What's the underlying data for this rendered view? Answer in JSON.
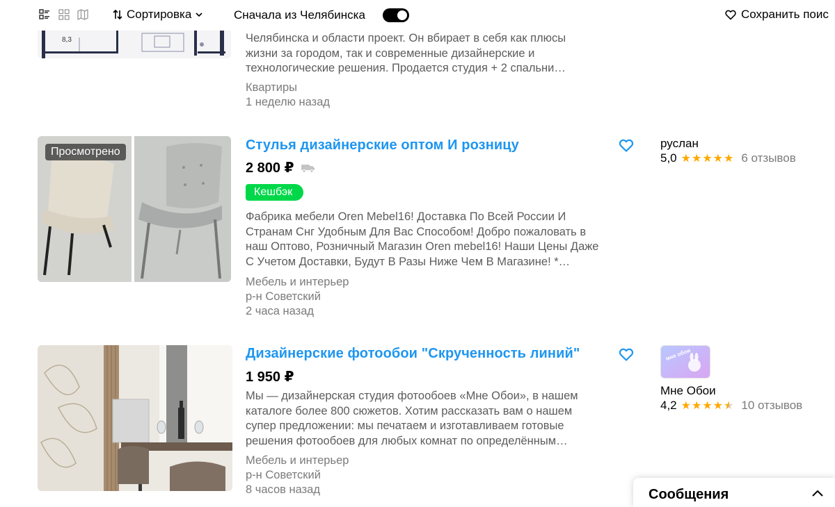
{
  "toolbar": {
    "view_icons": [
      "list-view-icon",
      "grid-view-icon",
      "map-view-icon"
    ],
    "sort_label": "Сортировка",
    "first_from_label": "Сначала из Челябинска",
    "toggle_on": true,
    "save_search_label": "Сохранить поис"
  },
  "listings": [
    {
      "description": "Челябинска и области проект. Он вбирает в себя как плюсы жизни за городом, так и современные дизайнерские и технологические решения. Продается студия + 2 спальни…",
      "description_lines": [
        "Челябинска и области проект. Он вбирает в себя как плюсы",
        "жизни за городом, так и современные дизайнерские и",
        "технологические решения. Продается студия + 2 спальни…"
      ],
      "category": "Квартиры",
      "time": "1 неделю назад",
      "thumb_text": "8,3"
    },
    {
      "viewed_label": "Просмотрено",
      "title": "Стулья дизайнерские оптом И розницу",
      "price": "2 800 ₽",
      "delivery_icon": "truck-icon",
      "cashback_label": "Кешбэк",
      "description_lines": [
        "Фабрика мебели Oren Mebel16! Доставка По Всей России И",
        "Странам Снг Удобным Для Вас Способом! Добро пожаловать в",
        "наш Оптово, Розничный Магазин Oren mebel16! Наши Цены Даже",
        "С Учетом Доставки, Будут В Разы Ниже Чем В Магазине! *…"
      ],
      "category": "Мебель и интерьер",
      "location": "р-н Советский",
      "time": "2 часа назад",
      "seller": {
        "name": "руслан",
        "rating": "5,0",
        "stars": "★★★★★",
        "reviews": "6 отзывов"
      }
    },
    {
      "title": "Дизайнерские фотообои \"Скрученность линий\"",
      "price": "1 950 ₽",
      "description_lines": [
        "Мы — дизайнерская студия фотообоев «Мне Обои», в нашем",
        "каталоге более 800 сюжетов. Хотим рассказать вам о нашем",
        "супер предложении: мы печатаем и изготавливаем готовые",
        "решения фотообоев для любых комнат по определённым…"
      ],
      "category": "Мебель и интерьер",
      "location": "р-н Советский",
      "time": "8 часов назад",
      "seller": {
        "name": "Мне Обои",
        "logo_text": "мне обои",
        "rating": "4,2",
        "stars": "★★★★",
        "half_star": "★",
        "reviews": "10 отзывов"
      }
    }
  ],
  "messages_panel": {
    "label": "Сообщения"
  },
  "colors": {
    "link_blue": "#1e96f0",
    "star_orange": "#ffa800",
    "cashback_green": "#00d84a",
    "muted_text": "#7b7b7b"
  }
}
